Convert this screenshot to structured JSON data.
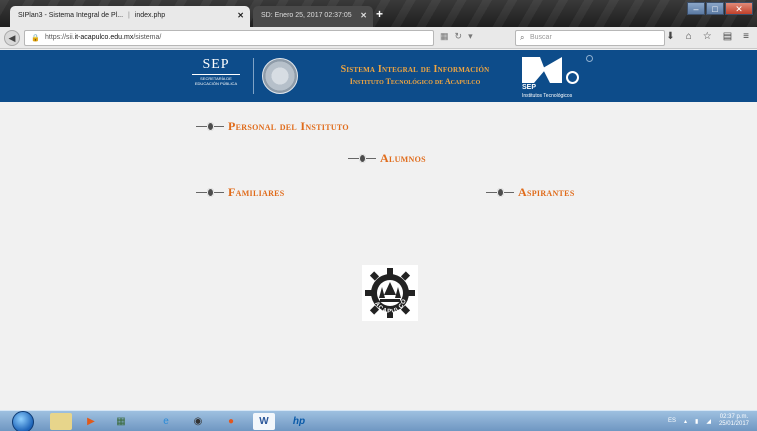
{
  "browser": {
    "tabs": [
      {
        "title": "SIPlan3 - Sistema Integral de Pl...",
        "close": "✕"
      },
      {
        "title": "index.php",
        "close": "✕"
      },
      {
        "title": "SD: Enero 25, 2017 02:37:05",
        "close": "✕"
      }
    ],
    "new_tab": "+",
    "url_prefix": "https://sii.",
    "url_domain": "it-acapulco.edu.mx",
    "url_path": "/sistema/",
    "search_placeholder": "Buscar"
  },
  "header": {
    "sep_logo_big": "SEP",
    "sep_logo_small": "SECRETARÍA DE EDUCACIÓN PÚBLICA",
    "title_line1": "Sistema Integral de Información",
    "title_line2": "Instituto Tecnológico de Acapulco",
    "tecnm_sep": "SEP",
    "tecnm_text": "Institutos Tecnológicos"
  },
  "menu": {
    "personal": "Personal del Instituto",
    "alumnos": "Alumnos",
    "familiares": "Familiares",
    "aspirantes": "Aspirantes"
  },
  "logo": {
    "text": "ACAPULCO"
  },
  "taskbar": {
    "lang": "ES",
    "time": "02:37 p.m.",
    "date": "25/01/2017"
  }
}
